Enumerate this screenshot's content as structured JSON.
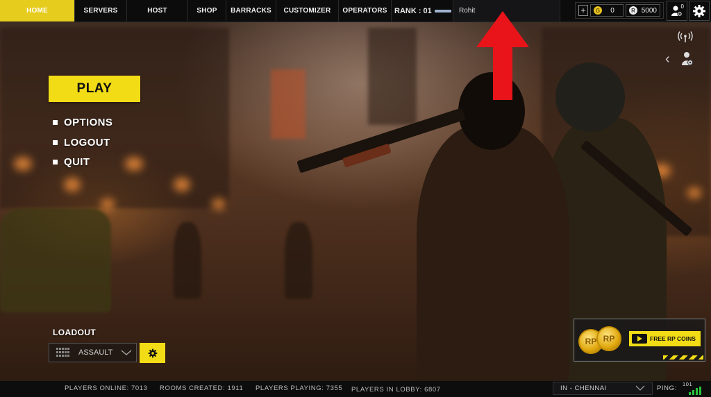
{
  "nav": {
    "items": [
      {
        "label": "HOME",
        "active": true
      },
      {
        "label": "SERVERS",
        "active": false
      },
      {
        "label": "HOST",
        "active": false
      },
      {
        "label": "SHOP",
        "active": false
      },
      {
        "label": "BARRACKS",
        "active": false
      },
      {
        "label": "CUSTOMIZER",
        "active": false
      },
      {
        "label": "OPERATORS",
        "active": false
      }
    ],
    "active_color": "#e6cc1c"
  },
  "profile": {
    "rank_label": "RANK : 01",
    "player_name": "Rohit"
  },
  "currency": {
    "plus_label": "+",
    "gold_symbol": "G",
    "gold_value": "0",
    "rp_symbol": "R",
    "rp_value": "5000"
  },
  "friends": {
    "count": "0",
    "icon": "friends-icon"
  },
  "settings": {
    "icon": "gear-icon"
  },
  "main_menu": {
    "play_label": "PLAY",
    "items": [
      "OPTIONS",
      "LOGOUT",
      "QUIT"
    ]
  },
  "loadout": {
    "title": "LOADOUT",
    "selected": "ASSAULT"
  },
  "rp_banner": {
    "coin_label": "RP",
    "cta_label": "FREE RP COINS"
  },
  "status": {
    "players_online": "PLAYERS ONLINE: 7013",
    "rooms_created": "ROOMS CREATED: 1911",
    "players_playing": "PLAYERS PLAYING: 7355",
    "players_in_lobby": "PLAYERS IN LOBBY: 6807",
    "region": "IN - CHENNAI",
    "ping_label": "PING:",
    "ping_value": "101"
  },
  "colors": {
    "accent_yellow": "#f2dc16",
    "arrow_red": "#e8141a",
    "ping_green": "#29c23a"
  }
}
